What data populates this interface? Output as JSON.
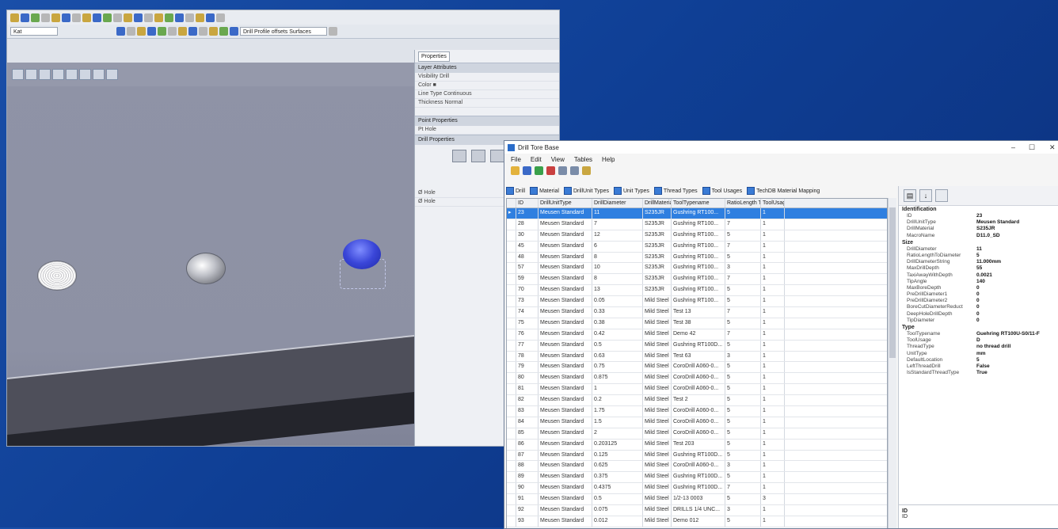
{
  "cad": {
    "toolbar_combo1": "Kat",
    "toolbar_combo2": "Drill Profile offsets Surfaces",
    "properties_tab": "Properties",
    "panels": [
      {
        "header": "Layer Attributes",
        "rows": [
          "Visibility  Drill",
          "Color  ■",
          "Line Type  Continuous",
          "Thickness  Normal"
        ]
      },
      {
        "header": "Point Properties",
        "rows": [
          "Pt  Hole"
        ]
      },
      {
        "header": "Drill Properties",
        "rows": []
      }
    ],
    "extra_rows": [
      "Ø  Hole",
      "Ø  Hole"
    ]
  },
  "db": {
    "title": "Drill Tore Base",
    "menu": [
      "File",
      "Edit",
      "View",
      "Tables",
      "Help"
    ],
    "window_controls": [
      "–",
      "☐",
      "✕"
    ],
    "tabs": [
      "Drill",
      "Material",
      "DrillUnit Types",
      "Unit Types",
      "Thread Types",
      "Tool Usages",
      "TechDB Material Mapping"
    ],
    "columns": [
      "",
      "ID",
      "DrillUnitType",
      "DrillDiameter",
      "DrillMaterial",
      "ToolTypename",
      "RatioLength ToDiam",
      "ToolUsage"
    ],
    "rows": [
      [
        "▸",
        "23",
        "Meusen Standard",
        "11",
        "S235JR",
        "Gushring RT100...",
        "5",
        "1"
      ],
      [
        "",
        "28",
        "Meusen Standard",
        "7",
        "S235JR",
        "Gushring RT100...",
        "7",
        "1"
      ],
      [
        "",
        "30",
        "Meusen Standard",
        "12",
        "S235JR",
        "Gushring RT100...",
        "5",
        "1"
      ],
      [
        "",
        "45",
        "Meusen Standard",
        "6",
        "S235JR",
        "Gushring RT100...",
        "7",
        "1"
      ],
      [
        "",
        "48",
        "Meusen Standard",
        "8",
        "S235JR",
        "Gushring RT100...",
        "5",
        "1"
      ],
      [
        "",
        "57",
        "Meusen Standard",
        "10",
        "S235JR",
        "Gushring RT100...",
        "3",
        "1"
      ],
      [
        "",
        "59",
        "Meusen Standard",
        "8",
        "S235JR",
        "Gushring RT100...",
        "7",
        "1"
      ],
      [
        "",
        "70",
        "Meusen Standard",
        "13",
        "S235JR",
        "Gushring RT100...",
        "5",
        "1"
      ],
      [
        "",
        "73",
        "Meusen Standard",
        "0.05",
        "Mild Steel",
        "Gushring RT100...",
        "5",
        "1"
      ],
      [
        "",
        "74",
        "Meusen Standard",
        "0.33",
        "Mild Steel",
        "Test  13",
        "7",
        "1"
      ],
      [
        "",
        "75",
        "Meusen Standard",
        "0.38",
        "Mild Steel",
        "Test  38",
        "5",
        "1"
      ],
      [
        "",
        "76",
        "Meusen Standard",
        "0.42",
        "Mild Steel",
        "Demo  42",
        "7",
        "1"
      ],
      [
        "",
        "77",
        "Meusen Standard",
        "0.5",
        "Mild Steel",
        "Gushring RT100D...",
        "5",
        "1"
      ],
      [
        "",
        "78",
        "Meusen Standard",
        "0.63",
        "Mild Steel",
        "Test  63",
        "3",
        "1"
      ],
      [
        "",
        "79",
        "Meusen Standard",
        "0.75",
        "Mild Steel",
        "CoroDrill A060-0...",
        "5",
        "1"
      ],
      [
        "",
        "80",
        "Meusen Standard",
        "0.875",
        "Mild Steel",
        "CoroDrill A060-0...",
        "5",
        "1"
      ],
      [
        "",
        "81",
        "Meusen Standard",
        "1",
        "Mild Steel",
        "CoroDrill A060-0...",
        "5",
        "1"
      ],
      [
        "",
        "82",
        "Meusen Standard",
        "0.2",
        "Mild Steel",
        "Test  2",
        "5",
        "1"
      ],
      [
        "",
        "83",
        "Meusen Standard",
        "1.75",
        "Mild Steel",
        "CoroDrill A060-0...",
        "5",
        "1"
      ],
      [
        "",
        "84",
        "Meusen Standard",
        "1.5",
        "Mild Steel",
        "CoroDrill A060-0...",
        "5",
        "1"
      ],
      [
        "",
        "85",
        "Meusen Standard",
        "2",
        "Mild Steel",
        "CoroDrill A060-0...",
        "5",
        "1"
      ],
      [
        "",
        "86",
        "Meusen Standard",
        "0.203125",
        "Mild Steel",
        "Test  203",
        "5",
        "1"
      ],
      [
        "",
        "87",
        "Meusen Standard",
        "0.125",
        "Mild Steel",
        "Gushring RT100D...",
        "5",
        "1"
      ],
      [
        "",
        "88",
        "Meusen Standard",
        "0.625",
        "Mild Steel",
        "CoroDrill A060-0...",
        "3",
        "1"
      ],
      [
        "",
        "89",
        "Meusen Standard",
        "0.375",
        "Mild Steel",
        "Gushring RT100D...",
        "5",
        "1"
      ],
      [
        "",
        "90",
        "Meusen Standard",
        "0.4375",
        "Mild Steel",
        "Gushring RT100D...",
        "7",
        "1"
      ],
      [
        "",
        "91",
        "Meusen Standard",
        "0.5",
        "Mild Steel",
        "1/2-13 0003",
        "5",
        "3"
      ],
      [
        "",
        "92",
        "Meusen Standard",
        "0.075",
        "Mild Steel",
        "DRILLS 1/4 UNC...",
        "3",
        "1"
      ],
      [
        "",
        "93",
        "Meusen Standard",
        "0.012",
        "Mild Steel",
        "Demo  012",
        "5",
        "1"
      ]
    ],
    "property_grid": {
      "sections": [
        {
          "name": "Identification",
          "items": [
            [
              "ID",
              "23"
            ],
            [
              "DrillUnitType",
              "Meusen Standard"
            ],
            [
              "DrillMaterial",
              "S235JR"
            ],
            [
              "MacroName",
              "D11.0_SD"
            ]
          ]
        },
        {
          "name": "Size",
          "items": [
            [
              "DrillDiameter",
              "11"
            ],
            [
              "RatioLengthToDiameter",
              "5"
            ],
            [
              "DrillDiameterString",
              "11.000mm"
            ],
            [
              "MaxDrillDepth",
              "55"
            ],
            [
              "TaxiAwayWithDepth",
              "0.0021"
            ],
            [
              "TipAngle",
              "140"
            ],
            [
              "MaxBoreDepth",
              "0"
            ],
            [
              "PreDrillDiameter1",
              "0"
            ],
            [
              "PreDrillDiameter2",
              "0"
            ],
            [
              "BoreCutDiameterReduct",
              "0"
            ],
            [
              "DeepHoleDrillDepth",
              "0"
            ],
            [
              "TipDiameter",
              "0"
            ]
          ]
        },
        {
          "name": "Type",
          "items": [
            [
              "ToolTypename",
              "Guehring RT100U-S0/11-F"
            ],
            [
              "ToolUsage",
              "D"
            ],
            [
              "ThreadType",
              "no thread drill"
            ],
            [
              "UnitType",
              "mm"
            ],
            [
              "DefaultLocation",
              "5"
            ],
            [
              "LeftThreadDrill",
              "False"
            ],
            [
              "IsStandardThreadType",
              "True"
            ]
          ]
        }
      ],
      "description_title": "ID",
      "description_text": "ID"
    }
  }
}
